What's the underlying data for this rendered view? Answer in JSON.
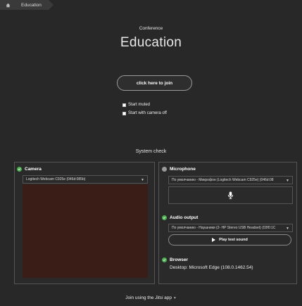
{
  "breadcrumb": {
    "items": [
      "Education"
    ]
  },
  "conference": {
    "label": "Conference",
    "title": "Education"
  },
  "join_button": {
    "label": "click here to join"
  },
  "options": {
    "start_muted": "Start muted",
    "start_camera_off": "Start with camera off"
  },
  "system_check": {
    "title": "System check",
    "camera": {
      "label": "Camera",
      "device": "Logitech Webcam C925e (046d:085b)"
    },
    "microphone": {
      "label": "Microphone",
      "device": "По умолчанию - Микрофон (Logitech Webcam C925e) (046d:08"
    },
    "audio_output": {
      "label": "Audio output",
      "device": "По умолчанию - Наушники (2- HP Stereo USB Headset) (03f0:1C",
      "play_label": "Play test sound"
    },
    "browser": {
      "label": "Browser",
      "value": "Desktop: Microsoft Edge (108.0.1462.54)"
    }
  },
  "footer": {
    "prefix": "Join using the",
    "app": "Jitsi",
    "suffix": "app"
  },
  "colors": {
    "success": "#4caf50",
    "background": "#282828",
    "camera_preview": "#3b1d17"
  }
}
